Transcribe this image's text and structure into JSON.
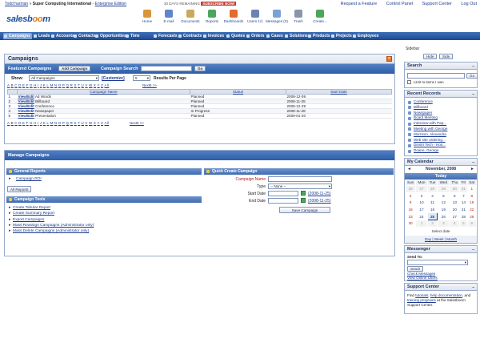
{
  "topbar": {
    "user": "Todd harman",
    "company_sep": "»",
    "company": "Super Computing International",
    "edition": "Enterprise Edition",
    "days_remaining": "30 DAYS REMAINING",
    "subscribe": "SUBSCRIBE NOW!",
    "links": [
      "Request a Feature",
      "Control Panel",
      "Support Center",
      "Log Out"
    ]
  },
  "header": {
    "logo_main": "salesb",
    "logo_o": "oo",
    "logo_end": "m",
    "tools": [
      {
        "label": "Home",
        "icon": "home-icon",
        "color": "#d9953a"
      },
      {
        "label": "E-mail",
        "icon": "email-icon",
        "color": "#5f86c9"
      },
      {
        "label": "Documents",
        "icon": "documents-icon",
        "color": "#c9a95f"
      },
      {
        "label": "Reports",
        "icon": "reports-icon",
        "color": "#4aa75a"
      },
      {
        "label": "Dashboards",
        "icon": "dashboards-icon",
        "color": "#e26b2d"
      },
      {
        "label": "Users 1/1",
        "icon": "users-icon",
        "color": "#6b82b8"
      },
      {
        "label": "Messages (0)",
        "icon": "messages-icon",
        "color": "#7aa2d8"
      },
      {
        "label": "Trash",
        "icon": "trash-icon",
        "color": "#8a95a8"
      },
      {
        "label": "Create...",
        "icon": "create-icon",
        "color": "#4aa75a"
      }
    ]
  },
  "nav": {
    "tabs": [
      "Campaigns",
      "Leads",
      "Accounts",
      "Contacts",
      "Opportunities",
      "Time Sheets",
      "Forecasts",
      "Contracts",
      "Invoices",
      "Quotes",
      "Orders",
      "Cases",
      "Solutions",
      "Products",
      "Projects",
      "Employees"
    ],
    "active_index": 0
  },
  "campaigns_panel": {
    "title": "Campaigns",
    "featured_label": "Featured Campaigns",
    "add_button": "Add Campaign",
    "search_label": "Campaign Search",
    "search_value": "",
    "go_button": "Go",
    "show_label": "Show:",
    "show_value": "All Campaigns",
    "customize_link": "[Customize]",
    "per_page_value": "5",
    "per_page_label": "Results Per Page",
    "alphabet": [
      "A",
      "B",
      "C",
      "D",
      "E",
      "F",
      "G",
      "H",
      "I",
      "J",
      "K",
      "L",
      "M",
      "N",
      "O",
      "P",
      "Q",
      "R",
      "S",
      "T",
      "U",
      "V",
      "W",
      "X",
      "Y",
      "Z",
      "All"
    ],
    "next_link": "Next5 >>",
    "columns": [
      "",
      "Campaign Name",
      "Status",
      "Start Date"
    ],
    "rows": [
      {
        "num": "1",
        "action": "View/Edit",
        "name": "Ad Words",
        "status": "Planned",
        "date": "2008-12-09"
      },
      {
        "num": "2",
        "action": "View/Edit",
        "name": "Billboard",
        "status": "Planned",
        "date": "2008-11-25"
      },
      {
        "num": "3",
        "action": "View/Edit",
        "name": "Conference",
        "status": "Planned",
        "date": "2008-12-29"
      },
      {
        "num": "4",
        "action": "View/Edit",
        "name": "Newspaper",
        "status": "In Progress",
        "date": "2008-11-28"
      },
      {
        "num": "5",
        "action": "View/Edit",
        "name": "Presentation",
        "status": "Planned",
        "date": "2009-01-20"
      }
    ]
  },
  "manage_panel": {
    "title": "Manage Campaigns",
    "general_reports": "General Reports",
    "campaign_roi": "Campaign ROI",
    "all_reports": "All Reports",
    "tools_title": "Campaign Tools",
    "tools": [
      "Create Tabular Report",
      "Create Summary Report",
      "Export Campaigns",
      "Mass Reassign Campaigns (Administrator only)",
      "Mass Delete Campaigns (Administrator only)"
    ],
    "quick_create": {
      "title": "Quick Create Campaign",
      "name_label": "Campaign Name",
      "type_label": "Type",
      "type_value": "-- None --",
      "start_label": "Start Date",
      "start_value": "(2008-11-25)",
      "end_label": "End Date",
      "end_value": "(2008-11-25)",
      "save_button": "Save Campaign"
    }
  },
  "sidebar": {
    "sidebar_label": "Sidebar",
    "hide_button": "Hide",
    "side_button": "Side",
    "search_title": "Search",
    "search_go": "Go",
    "limit_label": "Limit to items I own",
    "recent_title": "Recent Records",
    "recent": [
      "Conference",
      "Billboard",
      "Newspaper",
      "Board Meeting",
      "Interview with Pap...",
      "Meeting with George",
      "Morrison, Alexandra",
      "Web site ordering...",
      "Dimitri Tech - Hos...",
      "Doane, George"
    ],
    "calendar_title": "My Calendar",
    "month": "November, 2008",
    "today_label": "Today",
    "dow": [
      "Sun",
      "Mon",
      "Tue",
      "Wed",
      "Thu",
      "Fri",
      "Sat"
    ],
    "weeks": [
      [
        "26",
        "27",
        "28",
        "29",
        "30",
        "31",
        "1"
      ],
      [
        "2",
        "3",
        "4",
        "5",
        "6",
        "7",
        "8"
      ],
      [
        "9",
        "10",
        "11",
        "12",
        "13",
        "14",
        "15"
      ],
      [
        "16",
        "17",
        "18",
        "19",
        "20",
        "21",
        "22"
      ],
      [
        "23",
        "24",
        "25",
        "26",
        "27",
        "28",
        "29"
      ],
      [
        "30",
        "1",
        "2",
        "3",
        "4",
        "5",
        "6"
      ]
    ],
    "today_day": "25",
    "select_date": "Select date",
    "view_links": "Day | Week | Month",
    "messenger_title": "Messenger",
    "send_to": "Send To:",
    "send_button": "Send!",
    "check_messages": "Check Messages",
    "view_online": "View Online Users",
    "support_title": "Support Center",
    "support_text_1": "Find",
    "support_link_1": "tutorials",
    "support_link_2": "help documentation",
    "support_text_2": ", and",
    "support_link_3": "training programs",
    "support_text_3": "at the Salesboom Support Center."
  },
  "colors": {
    "nav": "#2d5ea8",
    "accent": "#e8731d",
    "link": "#1a3a8f"
  }
}
